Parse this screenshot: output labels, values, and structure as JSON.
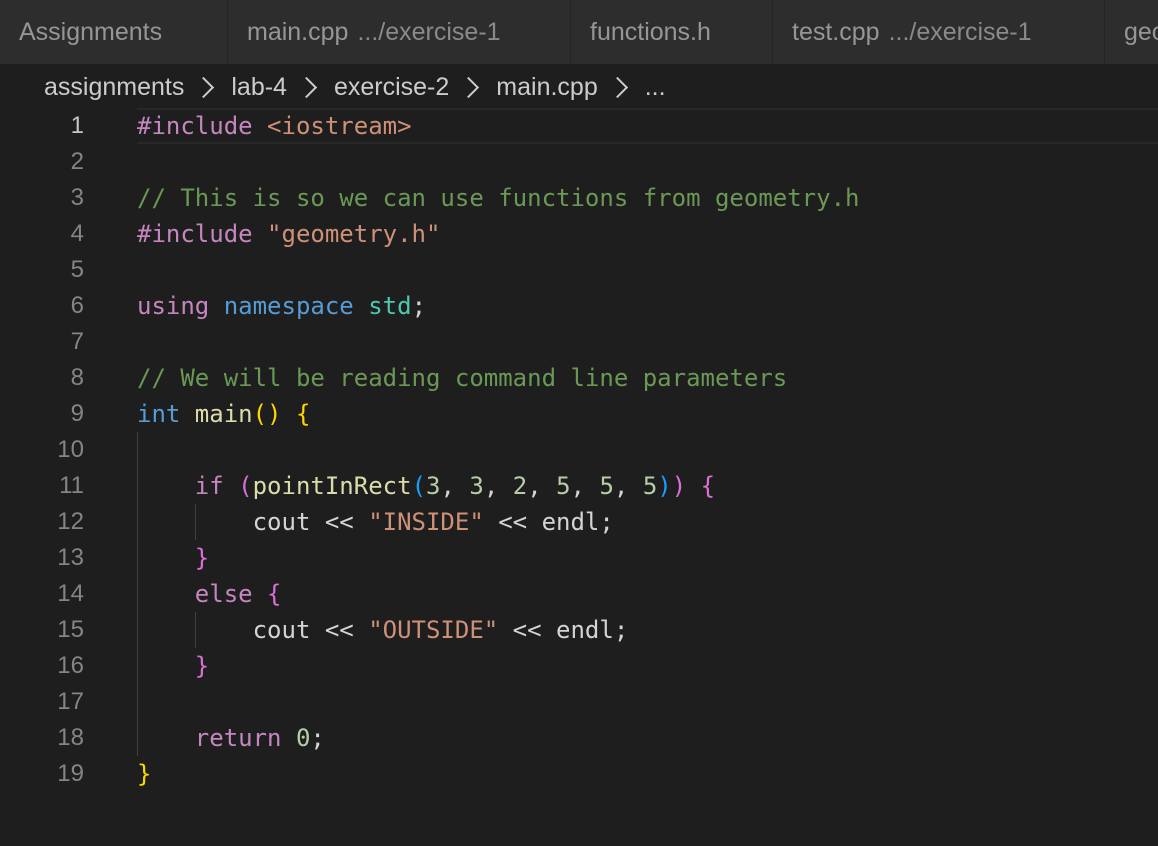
{
  "tabs": [
    {
      "label": "Assignments",
      "desc": ""
    },
    {
      "label": "main.cpp",
      "desc": ".../exercise-1"
    },
    {
      "label": "functions.h",
      "desc": ""
    },
    {
      "label": "test.cpp",
      "desc": ".../exercise-1"
    },
    {
      "label": "geo",
      "desc": ""
    }
  ],
  "breadcrumb": [
    "assignments",
    "lab-4",
    "exercise-2",
    "main.cpp",
    "..."
  ],
  "editor": {
    "active_line": 1,
    "line_numbers": [
      "1",
      "2",
      "3",
      "4",
      "5",
      "6",
      "7",
      "8",
      "9",
      "10",
      "11",
      "12",
      "13",
      "14",
      "15",
      "16",
      "17",
      "18",
      "19"
    ],
    "lines": [
      [
        {
          "t": "#include ",
          "c": "kw"
        },
        {
          "t": "<iostream>",
          "c": "str"
        }
      ],
      [],
      [
        {
          "t": "// This is so we can use functions from geometry.h",
          "c": "cmt"
        }
      ],
      [
        {
          "t": "#include ",
          "c": "kw"
        },
        {
          "t": "\"geometry.h\"",
          "c": "str"
        }
      ],
      [],
      [
        {
          "t": "using ",
          "c": "kw"
        },
        {
          "t": "namespace ",
          "c": "type"
        },
        {
          "t": "std",
          "c": "ns"
        },
        {
          "t": ";",
          "c": ""
        }
      ],
      [],
      [
        {
          "t": "// We will be reading command line parameters",
          "c": "cmt"
        }
      ],
      [
        {
          "t": "int ",
          "c": "type"
        },
        {
          "t": "main",
          "c": "fn"
        },
        {
          "t": "() {",
          "c": "br1"
        }
      ],
      [],
      [
        {
          "t": "    if ",
          "c": "ctrl"
        },
        {
          "t": "(",
          "c": "br2"
        },
        {
          "t": "pointInRect",
          "c": "fn"
        },
        {
          "t": "(",
          "c": "br3"
        },
        {
          "t": "3",
          "c": "num"
        },
        {
          "t": ", ",
          "c": ""
        },
        {
          "t": "3",
          "c": "num"
        },
        {
          "t": ", ",
          "c": ""
        },
        {
          "t": "2",
          "c": "num"
        },
        {
          "t": ", ",
          "c": ""
        },
        {
          "t": "5",
          "c": "num"
        },
        {
          "t": ", ",
          "c": ""
        },
        {
          "t": "5",
          "c": "num"
        },
        {
          "t": ", ",
          "c": ""
        },
        {
          "t": "5",
          "c": "num"
        },
        {
          "t": ")",
          "c": "br3"
        },
        {
          "t": ")",
          "c": "br2"
        },
        {
          "t": " {",
          "c": "br2"
        }
      ],
      [
        {
          "t": "        cout << ",
          "c": ""
        },
        {
          "t": "\"INSIDE\"",
          "c": "str"
        },
        {
          "t": " << endl;",
          "c": ""
        }
      ],
      [
        {
          "t": "    }",
          "c": "br2"
        }
      ],
      [
        {
          "t": "    else ",
          "c": "ctrl"
        },
        {
          "t": "{",
          "c": "br2"
        }
      ],
      [
        {
          "t": "        cout << ",
          "c": ""
        },
        {
          "t": "\"OUTSIDE\"",
          "c": "str"
        },
        {
          "t": " << endl;",
          "c": ""
        }
      ],
      [
        {
          "t": "    }",
          "c": "br2"
        }
      ],
      [],
      [
        {
          "t": "    return ",
          "c": "ctrl"
        },
        {
          "t": "0",
          "c": "num"
        },
        {
          "t": ";",
          "c": ""
        }
      ],
      [
        {
          "t": "}",
          "c": "br1"
        }
      ]
    ]
  }
}
